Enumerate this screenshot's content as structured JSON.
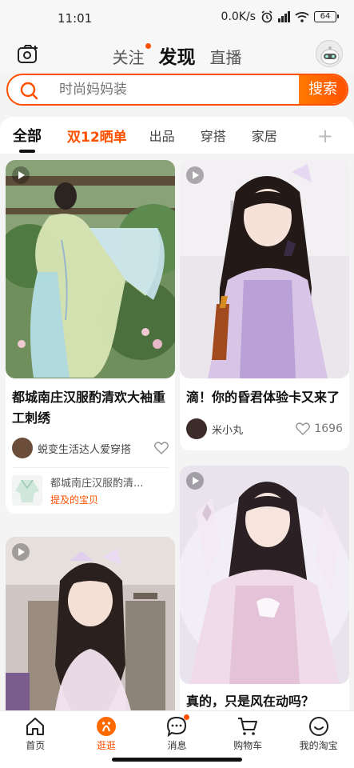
{
  "status_bar": {
    "time": "11:01",
    "network_speed": "0.0K/s",
    "battery": "64"
  },
  "top_nav": {
    "tabs": [
      {
        "label": "关注",
        "has_dot": true
      },
      {
        "label": "发现",
        "active": true
      },
      {
        "label": "直播"
      }
    ]
  },
  "search": {
    "placeholder": "时尚妈妈装",
    "button_label": "搜索"
  },
  "categories": {
    "items": [
      "全部",
      "双12晒单",
      "出品",
      "穿搭",
      "家居"
    ],
    "add_label": "+"
  },
  "feed": {
    "cards": [
      {
        "title": "都城南庄汉服酌清欢大袖重工刺绣",
        "author": "蜕变生活达人爱穿搭",
        "product": {
          "name": "都城南庄汉服酌清...",
          "tag": "提及的宝贝"
        }
      },
      {
        "title": "滴！你的昏君体验卡又来了",
        "author": "米小丸",
        "likes": "1696"
      },
      {
        "title": ""
      },
      {
        "title": "真的，只是风在动吗？"
      }
    ]
  },
  "tab_bar": {
    "items": [
      {
        "label": "首页",
        "icon": "home-icon"
      },
      {
        "label": "逛逛",
        "icon": "discover-icon",
        "active": true
      },
      {
        "label": "消息",
        "icon": "message-icon",
        "has_dot": true
      },
      {
        "label": "购物车",
        "icon": "cart-icon"
      },
      {
        "label": "我的淘宝",
        "icon": "profile-icon"
      }
    ]
  },
  "colors": {
    "accent": "#ff5000",
    "accent_light": "#ff7a00",
    "background": "#f4f4f4"
  }
}
